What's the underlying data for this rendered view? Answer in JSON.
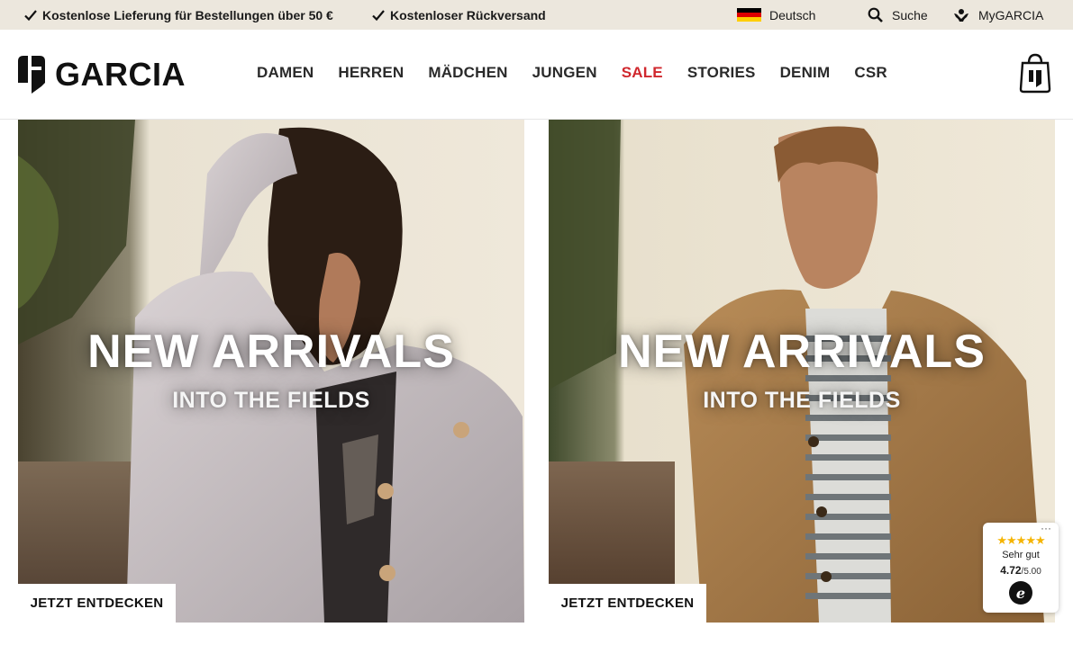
{
  "topbar": {
    "usp_1": "Kostenlose Lieferung für Bestellungen über 50 €",
    "usp_2": "Kostenloser Rückversand",
    "language": "Deutsch",
    "search": "Suche",
    "account": "MyGARCIA"
  },
  "header": {
    "logo": "GARCIA",
    "nav": [
      "DAMEN",
      "HERREN",
      "MÄDCHEN",
      "JUNGEN",
      "SALE",
      "STORIES",
      "DENIM",
      "CSR"
    ]
  },
  "tiles": [
    {
      "headline": "NEW ARRIVALS",
      "subline": "INTO THE FIELDS",
      "cta": "JETZT ENTDECKEN"
    },
    {
      "headline": "NEW ARRIVALS",
      "subline": "INTO THE FIELDS",
      "cta": "JETZT ENTDECKEN"
    }
  ],
  "trust_widget": {
    "stars": "★★★★★",
    "rating_text": "Sehr gut",
    "score": "4.72",
    "scale": "/5.00",
    "badge": "e"
  },
  "colors": {
    "topbar_bg": "#ece7dd",
    "sale_red": "#d0272d",
    "star_yellow": "#f5b400"
  },
  "icons": [
    "check-icon",
    "germany-flag-icon",
    "search-icon",
    "account-icon",
    "shopping-bag-icon",
    "more-icon"
  ]
}
